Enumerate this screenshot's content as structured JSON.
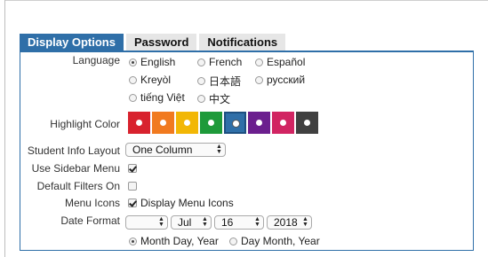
{
  "tabs": [
    {
      "label": "Display Options",
      "active": true
    },
    {
      "label": "Password",
      "active": false
    },
    {
      "label": "Notifications",
      "active": false
    }
  ],
  "language": {
    "label": "Language",
    "options": [
      "English",
      "French",
      "Español",
      "Kreyòl",
      "日本語",
      "русский",
      "tiếng Việt",
      "中文"
    ],
    "selected": "English"
  },
  "highlight": {
    "label": "Highlight Color",
    "colors": [
      "#d8222e",
      "#f17a1f",
      "#f2b705",
      "#1e9a3a",
      "#2f6fa8",
      "#6b1f8e",
      "#d12462",
      "#404040"
    ],
    "selected_index": 4
  },
  "layout": {
    "label": "Student Info Layout",
    "value": "One Column"
  },
  "sidebar": {
    "label": "Use Sidebar Menu",
    "checked": true
  },
  "filters": {
    "label": "Default Filters On",
    "checked": false
  },
  "menu_icons": {
    "label": "Menu Icons",
    "checked": true,
    "text": "Display Menu Icons"
  },
  "date": {
    "label": "Date Format",
    "blank": "",
    "month": "Jul",
    "day": "16",
    "year": "2018",
    "options": [
      "Month Day, Year",
      "Day Month, Year"
    ],
    "selected": "Month Day, Year"
  }
}
